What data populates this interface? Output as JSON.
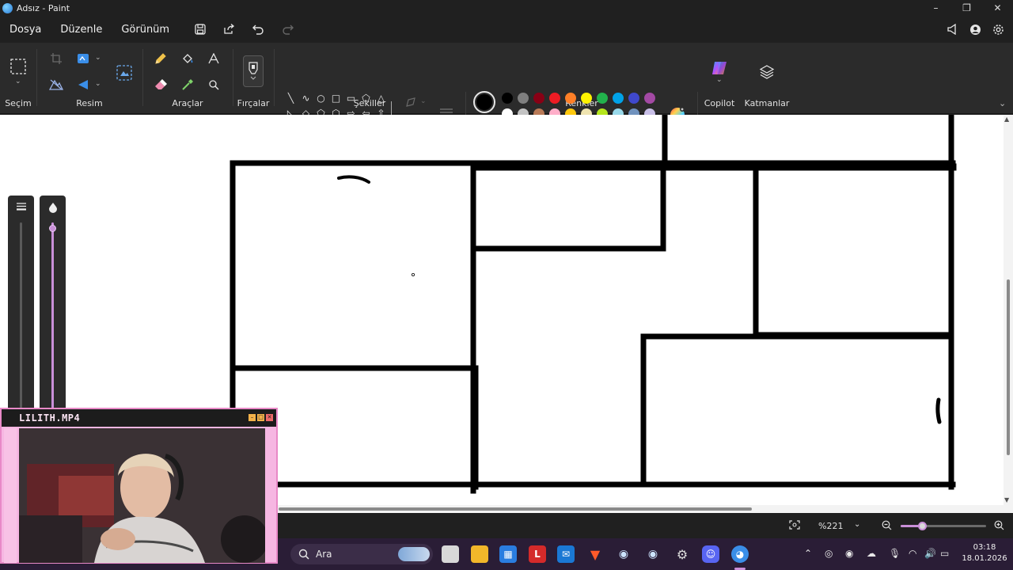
{
  "window": {
    "title": "Adsız - Paint",
    "controls": {
      "minimize": "–",
      "maximize": "❐",
      "close": "✕"
    }
  },
  "menu": {
    "items": [
      "Dosya",
      "Düzenle",
      "Görünüm"
    ],
    "quick_icons": [
      "save-icon",
      "share-icon",
      "undo-icon",
      "redo-icon"
    ],
    "right_icons": [
      "announcement-icon",
      "account-icon",
      "settings-icon"
    ]
  },
  "ribbon": {
    "groups": {
      "selection": "Seçim",
      "image": "Resim",
      "tools": "Araçlar",
      "brushes": "Fırçalar",
      "shapes": "Şekiller",
      "colors": "Renkler",
      "copilot": "Copilot",
      "layers": "Katmanlar"
    },
    "shapes": [
      "╲",
      "∿",
      "○",
      "□",
      "▭",
      "⬠",
      "△",
      "◺",
      "◇",
      "⬠",
      "⬡",
      "⇨",
      "⇦",
      "⇧",
      "⇩",
      "✦",
      "☆",
      "✶",
      "💬",
      "◯",
      "⬭"
    ],
    "colors": {
      "primary": "#000000",
      "secondary": "#ffffff",
      "row1": [
        "#000000",
        "#7f7f7f",
        "#880015",
        "#ed1c24",
        "#ff7f27",
        "#fff200",
        "#22b14c",
        "#00a2e8",
        "#3f48cc",
        "#a349a4"
      ],
      "row2": [
        "#ffffff",
        "#c3c3c3",
        "#b97a57",
        "#ffaec9",
        "#ffc90e",
        "#efe4b0",
        "#b5e61d",
        "#99d9ea",
        "#7092be",
        "#c8bfe7"
      ]
    }
  },
  "status": {
    "zoom": "%221",
    "zoom_level_fraction": 0.25
  },
  "taskbar": {
    "search_label": "Ara",
    "time": "03:18",
    "date": "18.01.2026"
  },
  "webcam": {
    "title": "LILITH.MP4"
  }
}
